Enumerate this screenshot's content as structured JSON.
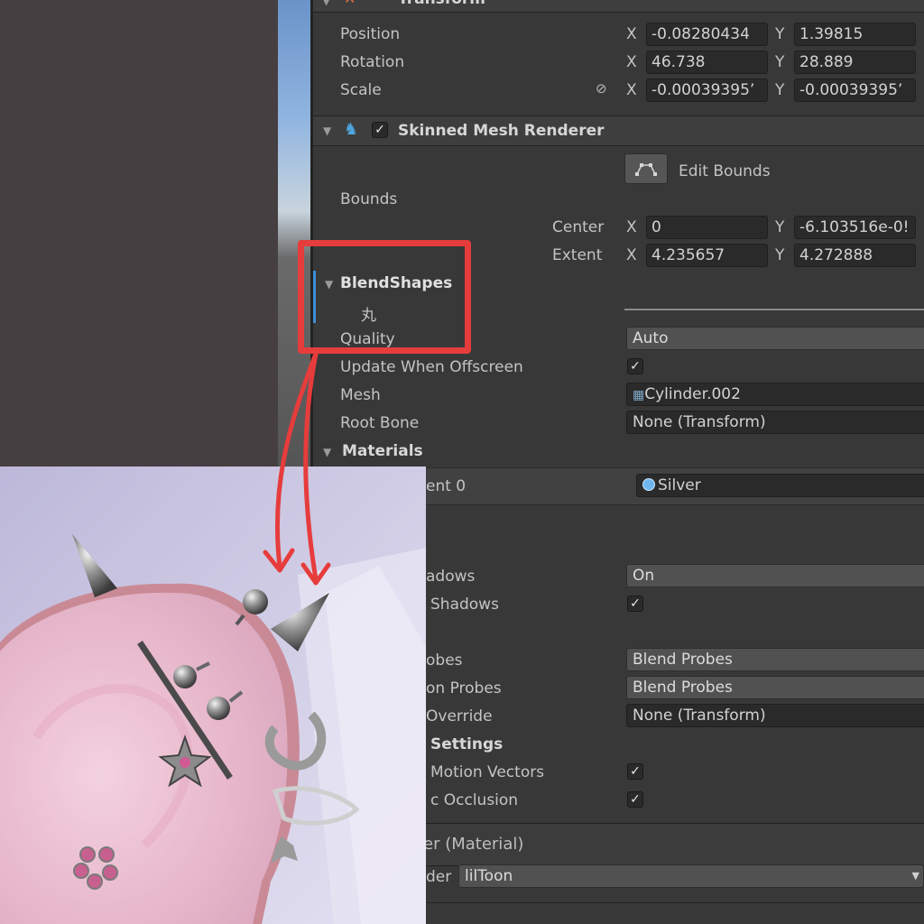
{
  "transform": {
    "title": "Transform",
    "position": {
      "label": "Position",
      "x_axis": "X",
      "x": "-0.08280434",
      "y_axis": "Y",
      "y": "1.39815"
    },
    "rotation": {
      "label": "Rotation",
      "x_axis": "X",
      "x": "46.738",
      "y_axis": "Y",
      "y": "28.889"
    },
    "scale": {
      "label": "Scale",
      "x_axis": "X",
      "x": "-0.00039395’",
      "y_axis": "Y",
      "y": "-0.00039395’"
    }
  },
  "smr": {
    "title": "Skinned Mesh Renderer",
    "edit_bounds": "Edit Bounds",
    "bounds_label": "Bounds",
    "center": {
      "label": "Center",
      "x_axis": "X",
      "x": "0",
      "y_axis": "Y",
      "y": "-6.103516e-0!"
    },
    "extent": {
      "label": "Extent",
      "x_axis": "X",
      "x": "4.235657",
      "y_axis": "Y",
      "y": "4.272888"
    },
    "blendshapes_label": "BlendShapes",
    "blendshape_item": "丸",
    "quality_label": "Quality",
    "quality_value": "Auto",
    "update_offscreen_label": "Update When Offscreen",
    "mesh_label": "Mesh",
    "mesh_value": "Cylinder.002",
    "root_bone_label": "Root Bone",
    "root_bone_value": "None (Transform)",
    "materials_label": "Materials",
    "element0_label": "ent 0",
    "element0_value": "Silver",
    "cast_shadows_label": "adows",
    "cast_shadows_value": "On",
    "receive_shadows_label": "Shadows",
    "light_probes_label": "obes",
    "light_probes_value": "Blend Probes",
    "reflection_probes_label": "on Probes",
    "reflection_probes_value": "Blend Probes",
    "anchor_override_label": "Override",
    "anchor_override_value": "None (Transform)",
    "additional_settings_label": "Settings",
    "motion_vectors_label": "Motion Vectors",
    "dynamic_occlusion_label": "c Occlusion"
  },
  "material": {
    "title": "er (Material)",
    "shader_label": "der",
    "shader_value": "lilToon"
  },
  "colors": {
    "highlight": "#e63c3c",
    "accent": "#3d8fd6"
  }
}
